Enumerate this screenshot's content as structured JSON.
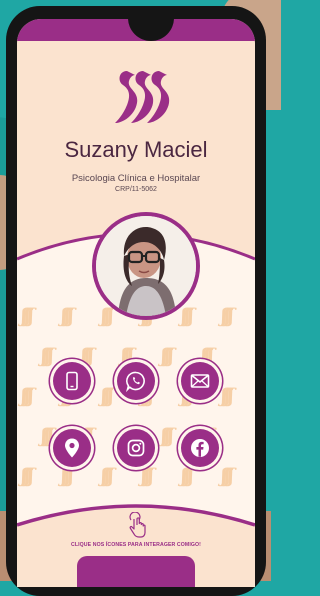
{
  "profile": {
    "name": "Suzany Maciel",
    "subtitle": "Psicologia Clínica e Hospitalar",
    "registration": "CRP/11-5062"
  },
  "contacts": [
    {
      "icon": "phone-icon"
    },
    {
      "icon": "whatsapp-icon"
    },
    {
      "icon": "email-icon"
    },
    {
      "icon": "location-pin-icon"
    },
    {
      "icon": "instagram-icon"
    },
    {
      "icon": "facebook-icon"
    }
  ],
  "footer": {
    "cta": "CLIQUE NOS ÍCONES PARA INTERAGER COMIGO!"
  },
  "colors": {
    "brand": "#9a2e87",
    "background": "#fbe3cf",
    "pattern": "#f6cfa6"
  }
}
